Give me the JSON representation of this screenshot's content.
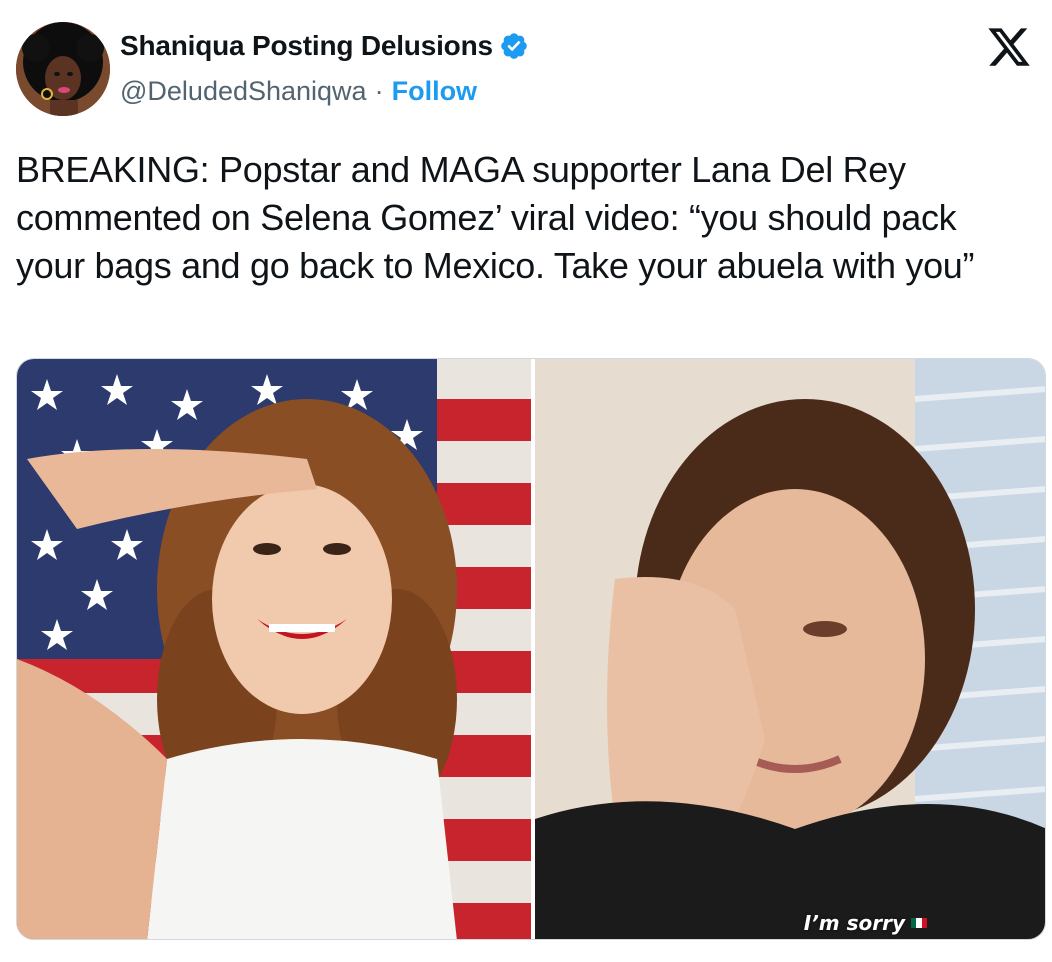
{
  "author": {
    "display_name": "Shaniqua Posting Delusions",
    "handle": "@DeludedShaniqwa",
    "separator": "·",
    "follow_label": "Follow"
  },
  "tweet": {
    "text": "BREAKING: Popstar and MAGA supporter Lana Del Rey commented on Selena Gomez’ viral video: “you should pack your bags and go back to Mexico. Take your abuela with you”"
  },
  "media": {
    "right_caption": "I’m sorry"
  },
  "colors": {
    "accent": "#1d9bf0",
    "secondary_text": "#536471",
    "primary_text": "#0f1419"
  },
  "icons": {
    "verified": "verified-badge-icon",
    "platform": "x-logo-icon"
  }
}
